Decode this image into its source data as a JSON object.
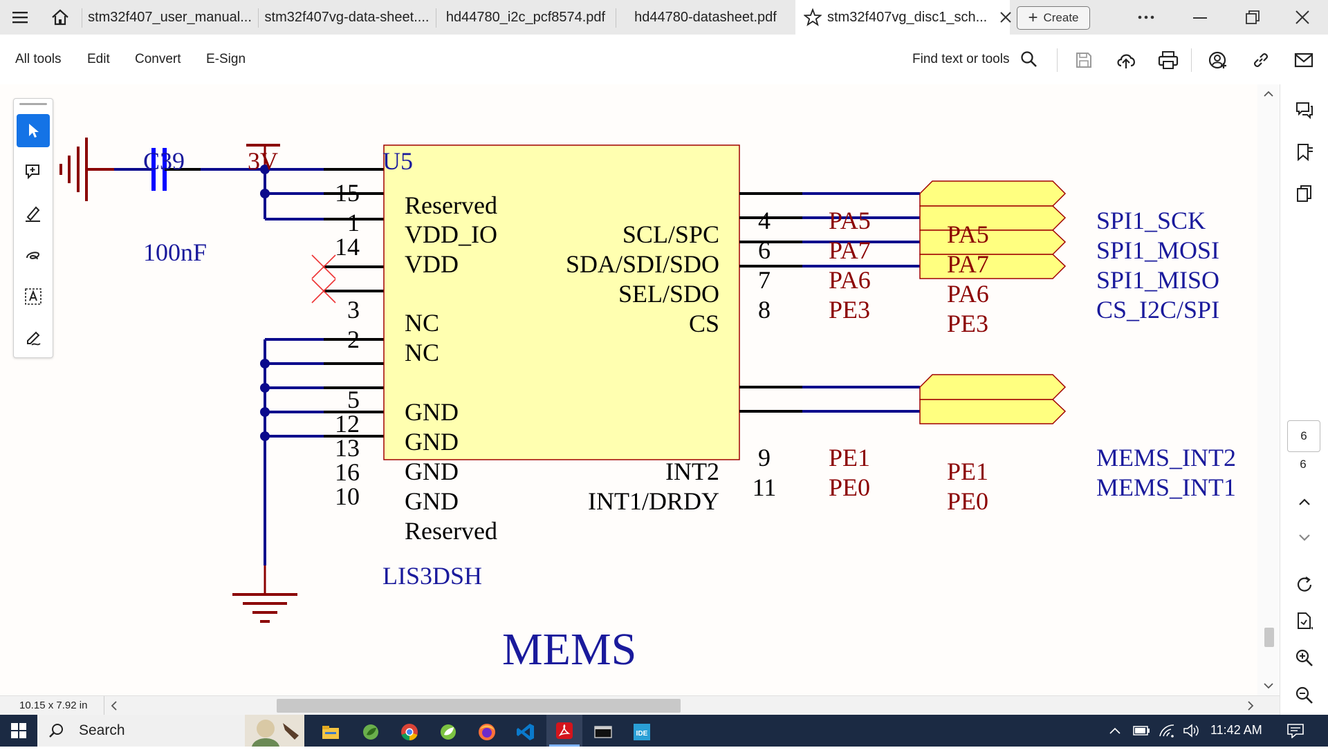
{
  "tabs": [
    {
      "label": "stm32f407_user_manual..."
    },
    {
      "label": "stm32f407vg-data-sheet...."
    },
    {
      "label": "hd44780_i2c_pcf8574.pdf"
    },
    {
      "label": "hd44780-datasheet.pdf"
    },
    {
      "label": "stm32f407vg_disc1_sch...",
      "active": true
    }
  ],
  "create_label": "Create",
  "toolbar": {
    "menu": [
      "All tools",
      "Edit",
      "Convert",
      "E-Sign"
    ],
    "find_label": "Find text or tools"
  },
  "schematic": {
    "capacitor": {
      "ref": "C39",
      "value": "100nF"
    },
    "supply": "3V",
    "chip": {
      "ref": "U5",
      "part": "LIS3DSH"
    },
    "left_pins": [
      {
        "num": "15",
        "name": "Reserved"
      },
      {
        "num": "1",
        "name": "VDD_IO"
      },
      {
        "num": "14",
        "name": "VDD"
      },
      {
        "num": "3",
        "name": "NC"
      },
      {
        "num": "2",
        "name": "NC"
      },
      {
        "num": "5",
        "name": "GND"
      },
      {
        "num": "12",
        "name": "GND"
      },
      {
        "num": "13",
        "name": "GND"
      },
      {
        "num": "16",
        "name": "GND"
      },
      {
        "num": "10",
        "name": "Reserved"
      }
    ],
    "right_pins": [
      {
        "num": "4",
        "name": "SCL/SPC",
        "net": "PA5",
        "port": "PA5",
        "signal": "SPI1_SCK"
      },
      {
        "num": "6",
        "name": "SDA/SDI/SDO",
        "net": "PA7",
        "port": "PA7",
        "signal": "SPI1_MOSI"
      },
      {
        "num": "7",
        "name": "SEL/SDO",
        "net": "PA6",
        "port": "PA6",
        "signal": "SPI1_MISO"
      },
      {
        "num": "8",
        "name": "CS",
        "net": "PE3",
        "port": "PE3",
        "signal": "CS_I2C/SPI"
      },
      {
        "num": "9",
        "name": "INT2",
        "net": "PE1",
        "port": "PE1",
        "signal": "MEMS_INT2"
      },
      {
        "num": "11",
        "name": "INT1/DRDY",
        "net": "PE0",
        "port": "PE0",
        "signal": "MEMS_INT1"
      }
    ],
    "section_title": "MEMS"
  },
  "page_size": "10.15 x 7.92 in",
  "page_nav": {
    "current": "6",
    "total": "6"
  },
  "taskbar": {
    "search_label": "Search",
    "time": "11:42 AM"
  },
  "colors": {
    "wire": "#0a0a8c",
    "pin_number": "#000000",
    "net_label": "#8b0000",
    "port_fill": "#ffff80",
    "chip_fill": "#ffffb0",
    "chip_border": "#a00000",
    "signal": "#1a1a9c",
    "power": "#8b0000",
    "cap": "#0000ff"
  }
}
